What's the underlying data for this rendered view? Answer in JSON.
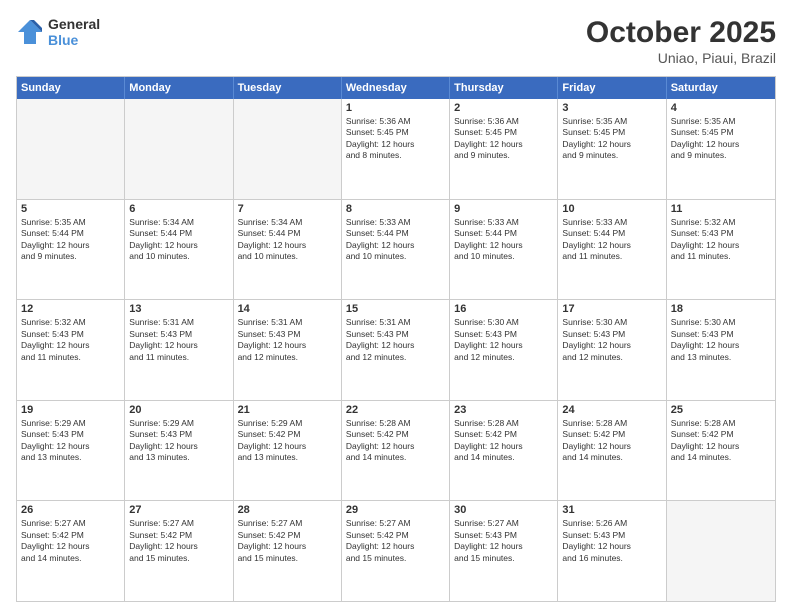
{
  "header": {
    "logo_line1": "General",
    "logo_line2": "Blue",
    "month": "October 2025",
    "location": "Uniao, Piaui, Brazil"
  },
  "weekdays": [
    "Sunday",
    "Monday",
    "Tuesday",
    "Wednesday",
    "Thursday",
    "Friday",
    "Saturday"
  ],
  "rows": [
    [
      {
        "day": "",
        "lines": [],
        "empty": true
      },
      {
        "day": "",
        "lines": [],
        "empty": true
      },
      {
        "day": "",
        "lines": [],
        "empty": true
      },
      {
        "day": "1",
        "lines": [
          "Sunrise: 5:36 AM",
          "Sunset: 5:45 PM",
          "Daylight: 12 hours",
          "and 8 minutes."
        ],
        "empty": false
      },
      {
        "day": "2",
        "lines": [
          "Sunrise: 5:36 AM",
          "Sunset: 5:45 PM",
          "Daylight: 12 hours",
          "and 9 minutes."
        ],
        "empty": false
      },
      {
        "day": "3",
        "lines": [
          "Sunrise: 5:35 AM",
          "Sunset: 5:45 PM",
          "Daylight: 12 hours",
          "and 9 minutes."
        ],
        "empty": false
      },
      {
        "day": "4",
        "lines": [
          "Sunrise: 5:35 AM",
          "Sunset: 5:45 PM",
          "Daylight: 12 hours",
          "and 9 minutes."
        ],
        "empty": false
      }
    ],
    [
      {
        "day": "5",
        "lines": [
          "Sunrise: 5:35 AM",
          "Sunset: 5:44 PM",
          "Daylight: 12 hours",
          "and 9 minutes."
        ],
        "empty": false
      },
      {
        "day": "6",
        "lines": [
          "Sunrise: 5:34 AM",
          "Sunset: 5:44 PM",
          "Daylight: 12 hours",
          "and 10 minutes."
        ],
        "empty": false
      },
      {
        "day": "7",
        "lines": [
          "Sunrise: 5:34 AM",
          "Sunset: 5:44 PM",
          "Daylight: 12 hours",
          "and 10 minutes."
        ],
        "empty": false
      },
      {
        "day": "8",
        "lines": [
          "Sunrise: 5:33 AM",
          "Sunset: 5:44 PM",
          "Daylight: 12 hours",
          "and 10 minutes."
        ],
        "empty": false
      },
      {
        "day": "9",
        "lines": [
          "Sunrise: 5:33 AM",
          "Sunset: 5:44 PM",
          "Daylight: 12 hours",
          "and 10 minutes."
        ],
        "empty": false
      },
      {
        "day": "10",
        "lines": [
          "Sunrise: 5:33 AM",
          "Sunset: 5:44 PM",
          "Daylight: 12 hours",
          "and 11 minutes."
        ],
        "empty": false
      },
      {
        "day": "11",
        "lines": [
          "Sunrise: 5:32 AM",
          "Sunset: 5:43 PM",
          "Daylight: 12 hours",
          "and 11 minutes."
        ],
        "empty": false
      }
    ],
    [
      {
        "day": "12",
        "lines": [
          "Sunrise: 5:32 AM",
          "Sunset: 5:43 PM",
          "Daylight: 12 hours",
          "and 11 minutes."
        ],
        "empty": false
      },
      {
        "day": "13",
        "lines": [
          "Sunrise: 5:31 AM",
          "Sunset: 5:43 PM",
          "Daylight: 12 hours",
          "and 11 minutes."
        ],
        "empty": false
      },
      {
        "day": "14",
        "lines": [
          "Sunrise: 5:31 AM",
          "Sunset: 5:43 PM",
          "Daylight: 12 hours",
          "and 12 minutes."
        ],
        "empty": false
      },
      {
        "day": "15",
        "lines": [
          "Sunrise: 5:31 AM",
          "Sunset: 5:43 PM",
          "Daylight: 12 hours",
          "and 12 minutes."
        ],
        "empty": false
      },
      {
        "day": "16",
        "lines": [
          "Sunrise: 5:30 AM",
          "Sunset: 5:43 PM",
          "Daylight: 12 hours",
          "and 12 minutes."
        ],
        "empty": false
      },
      {
        "day": "17",
        "lines": [
          "Sunrise: 5:30 AM",
          "Sunset: 5:43 PM",
          "Daylight: 12 hours",
          "and 12 minutes."
        ],
        "empty": false
      },
      {
        "day": "18",
        "lines": [
          "Sunrise: 5:30 AM",
          "Sunset: 5:43 PM",
          "Daylight: 12 hours",
          "and 13 minutes."
        ],
        "empty": false
      }
    ],
    [
      {
        "day": "19",
        "lines": [
          "Sunrise: 5:29 AM",
          "Sunset: 5:43 PM",
          "Daylight: 12 hours",
          "and 13 minutes."
        ],
        "empty": false
      },
      {
        "day": "20",
        "lines": [
          "Sunrise: 5:29 AM",
          "Sunset: 5:43 PM",
          "Daylight: 12 hours",
          "and 13 minutes."
        ],
        "empty": false
      },
      {
        "day": "21",
        "lines": [
          "Sunrise: 5:29 AM",
          "Sunset: 5:42 PM",
          "Daylight: 12 hours",
          "and 13 minutes."
        ],
        "empty": false
      },
      {
        "day": "22",
        "lines": [
          "Sunrise: 5:28 AM",
          "Sunset: 5:42 PM",
          "Daylight: 12 hours",
          "and 14 minutes."
        ],
        "empty": false
      },
      {
        "day": "23",
        "lines": [
          "Sunrise: 5:28 AM",
          "Sunset: 5:42 PM",
          "Daylight: 12 hours",
          "and 14 minutes."
        ],
        "empty": false
      },
      {
        "day": "24",
        "lines": [
          "Sunrise: 5:28 AM",
          "Sunset: 5:42 PM",
          "Daylight: 12 hours",
          "and 14 minutes."
        ],
        "empty": false
      },
      {
        "day": "25",
        "lines": [
          "Sunrise: 5:28 AM",
          "Sunset: 5:42 PM",
          "Daylight: 12 hours",
          "and 14 minutes."
        ],
        "empty": false
      }
    ],
    [
      {
        "day": "26",
        "lines": [
          "Sunrise: 5:27 AM",
          "Sunset: 5:42 PM",
          "Daylight: 12 hours",
          "and 14 minutes."
        ],
        "empty": false
      },
      {
        "day": "27",
        "lines": [
          "Sunrise: 5:27 AM",
          "Sunset: 5:42 PM",
          "Daylight: 12 hours",
          "and 15 minutes."
        ],
        "empty": false
      },
      {
        "day": "28",
        "lines": [
          "Sunrise: 5:27 AM",
          "Sunset: 5:42 PM",
          "Daylight: 12 hours",
          "and 15 minutes."
        ],
        "empty": false
      },
      {
        "day": "29",
        "lines": [
          "Sunrise: 5:27 AM",
          "Sunset: 5:42 PM",
          "Daylight: 12 hours",
          "and 15 minutes."
        ],
        "empty": false
      },
      {
        "day": "30",
        "lines": [
          "Sunrise: 5:27 AM",
          "Sunset: 5:43 PM",
          "Daylight: 12 hours",
          "and 15 minutes."
        ],
        "empty": false
      },
      {
        "day": "31",
        "lines": [
          "Sunrise: 5:26 AM",
          "Sunset: 5:43 PM",
          "Daylight: 12 hours",
          "and 16 minutes."
        ],
        "empty": false
      },
      {
        "day": "",
        "lines": [],
        "empty": true
      }
    ]
  ]
}
